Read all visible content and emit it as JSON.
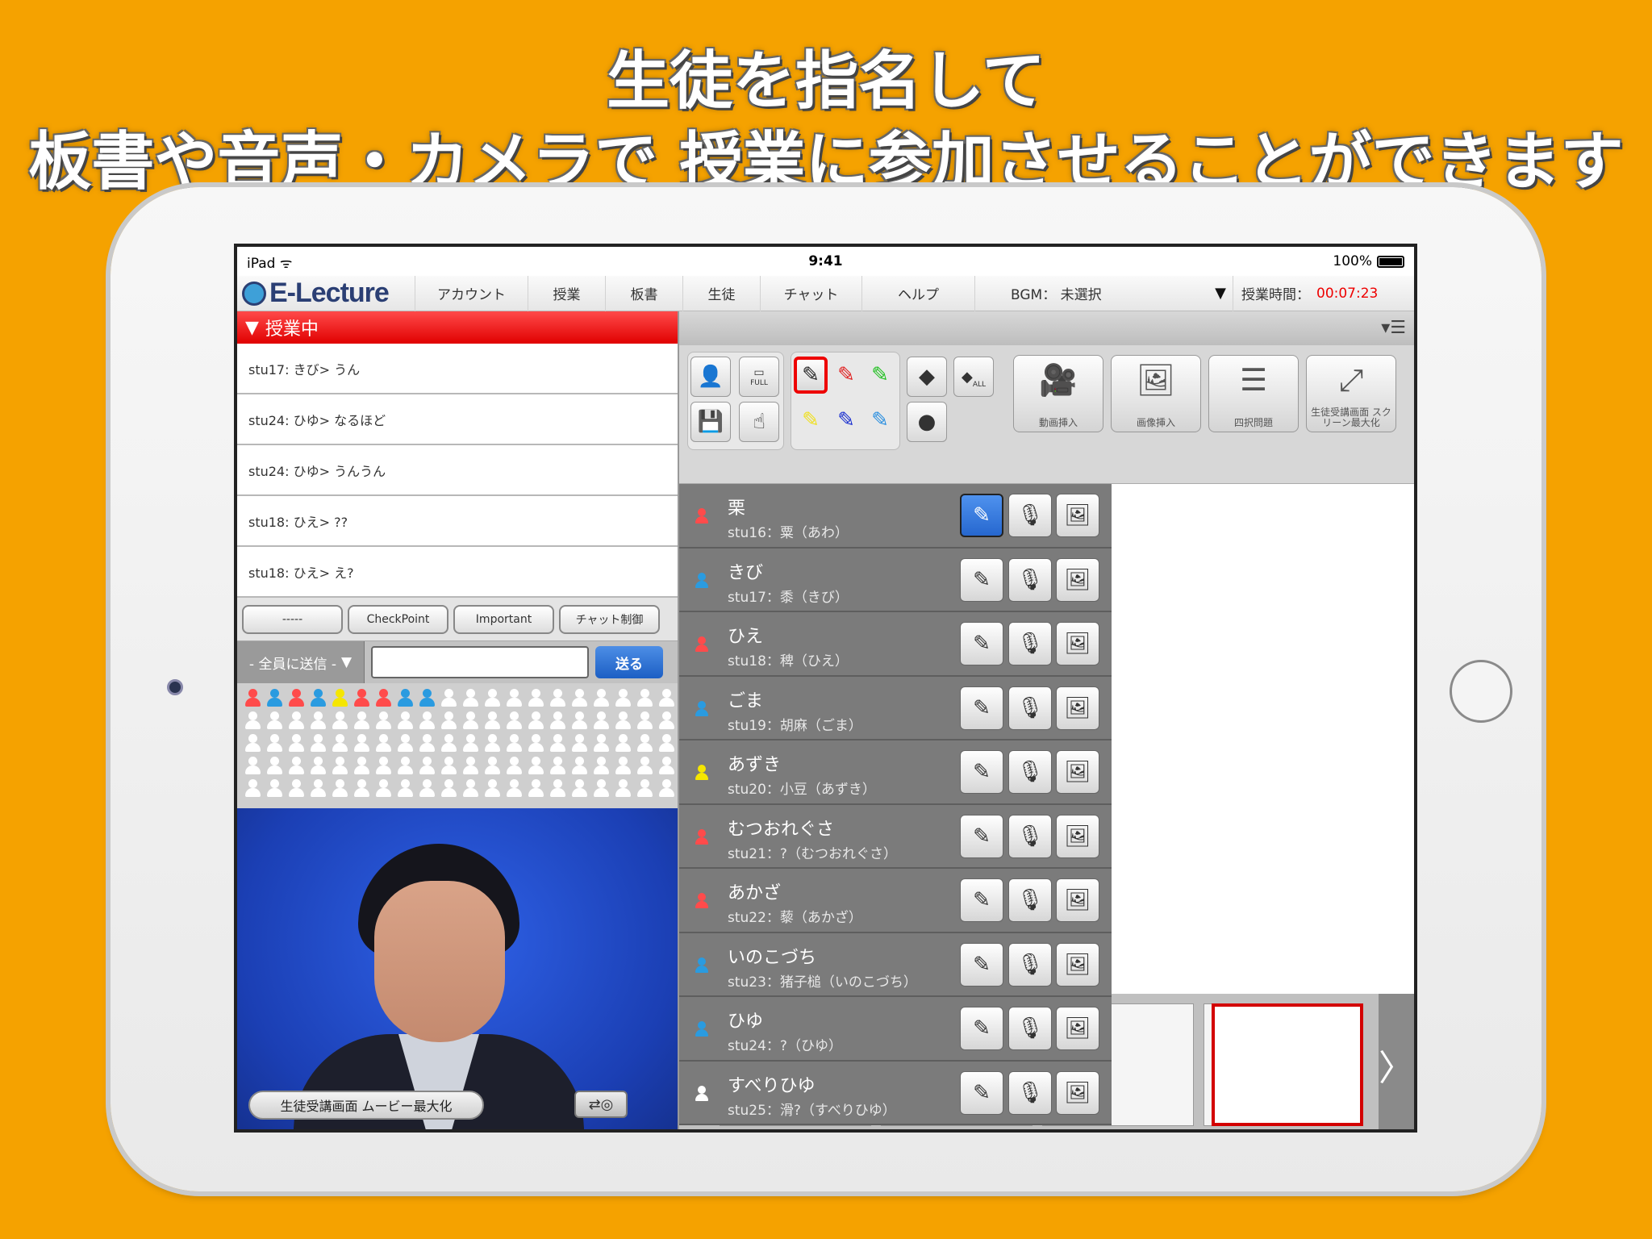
{
  "headline": {
    "line1": "生徒を指名して",
    "line2": "板書や音声・カメラで 授業に参加させることができます"
  },
  "status_bar": {
    "device": "iPad",
    "time": "9:41",
    "battery": "100%"
  },
  "menubar": {
    "logo": "E-Lecture",
    "items": [
      "アカウント",
      "授業",
      "板書",
      "生徒",
      "チャット",
      "ヘルプ"
    ],
    "bgm_label": "BGM：  未選択",
    "timer_label": "授業時間：",
    "timer_value": "00:07:23"
  },
  "chat": {
    "header": "授業中",
    "messages": [
      "stu17: きび> うん",
      "stu24: ひゆ> なるほど",
      "stu24: ひゆ> うんうん",
      "stu18: ひえ> ??",
      "stu18: ひえ> え?"
    ],
    "tool_buttons": [
      "-----",
      "CheckPoint",
      "Important",
      "チャット制御"
    ],
    "send_target": "- 全員に送信 -",
    "input_value": "",
    "send_label": "送る"
  },
  "seat_colors": [
    "#ff4b4b",
    "#2a9be0",
    "#ff4b4b",
    "#2a9be0",
    "#f5e600",
    "#ff4b4b",
    "#ff4b4b",
    "#2a9be0",
    "#2a9be0"
  ],
  "video": {
    "maximize_label": "生徒受講画面 ムービー最大化"
  },
  "toolbar": {
    "big_buttons": [
      {
        "label": "動画挿入",
        "icon": "video-camera-icon"
      },
      {
        "label": "画像挿入",
        "icon": "image-insert-icon"
      },
      {
        "label": "四択問題",
        "icon": "quiz-icon"
      },
      {
        "label": "生徒受講画面 スクリーン最大化",
        "icon": "maximize-icon"
      }
    ],
    "full_label": "FULL",
    "all_label": "ALL",
    "pen_colors": [
      "#222222",
      "#e02020",
      "#20c020",
      "#f0e020",
      "#1a2fd0",
      "#2a8fe0"
    ]
  },
  "students": [
    {
      "nick": "栗",
      "id": "stu16：粟（あわ）",
      "color": "#ff4b4b",
      "pen_active": true
    },
    {
      "nick": "きび",
      "id": "stu17：黍（きび）",
      "color": "#2a9be0",
      "pen_active": false
    },
    {
      "nick": "ひえ",
      "id": "stu18：稗（ひえ）",
      "color": "#ff4b4b",
      "pen_active": false
    },
    {
      "nick": "ごま",
      "id": "stu19：胡麻（ごま）",
      "color": "#2a9be0",
      "pen_active": false
    },
    {
      "nick": "あずき",
      "id": "stu20：小豆（あずき）",
      "color": "#f5e600",
      "pen_active": false
    },
    {
      "nick": "むつおれぐさ",
      "id": "stu21：?（むつおれぐさ）",
      "color": "#ff4b4b",
      "pen_active": false
    },
    {
      "nick": "あかざ",
      "id": "stu22：藜（あかざ）",
      "color": "#ff4b4b",
      "pen_active": false
    },
    {
      "nick": "いのこづち",
      "id": "stu23：猪子槌（いのこづち）",
      "color": "#2a9be0",
      "pen_active": false
    },
    {
      "nick": "ひゆ",
      "id": "stu24：?（ひゆ）",
      "color": "#2a9be0",
      "pen_active": false
    },
    {
      "nick": "すべりひゆ",
      "id": "stu25：滑?（すべりひゆ）",
      "color": "#ffffff",
      "pen_active": false
    }
  ]
}
